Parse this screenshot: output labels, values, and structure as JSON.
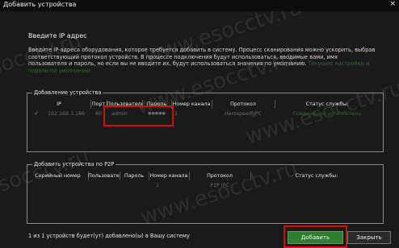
{
  "window": {
    "title": "Добавить устройства",
    "close_glyph": "×"
  },
  "intro": {
    "title": "Введите IP адрес",
    "description": "Введите IP-адреса оборудования, которое требуется добавить в систему. Процесс сканирования можно ускорить, выбрав соответствующий протокол устройств. В процессе подключения будут использоваться, вводимые вами, имя пользователя и пароль, но если вы не вводите их, будут использоваться значения по умолчанию.",
    "link": "Текущие настройки и пароли по умолчанию"
  },
  "add_group": {
    "title": "Добавление устройства",
    "columns": [
      "IP",
      "Порт",
      "Пользователь",
      "Пароль",
      "Номер канала",
      "Протокол",
      "Статус службы:"
    ],
    "rows": [
      {
        "checked": true,
        "check_glyph": "✔",
        "ip": "192.168.3.186",
        "port": "80",
        "user": "admin",
        "password": "●●●●●",
        "channel": "1",
        "protocol": "Herospeed|JPC",
        "status": "Соединение установлено"
      }
    ]
  },
  "p2p_group": {
    "title": "Добавить устройства по P2P",
    "columns": [
      "Серийный номер",
      "Пользователь",
      "Пароль",
      "Номер канала",
      "Протокол",
      "Статус службы:"
    ],
    "rows": [
      {
        "serial": "",
        "user": "",
        "password": "",
        "channel": "1",
        "protocol": "P2P IPC",
        "status": ""
      }
    ]
  },
  "footer": {
    "status_text": "1 из 1 устройств будет(ут) добавлено(ы) в Вашу систему",
    "add_label": "Добавить",
    "close_label": "Закрыть"
  },
  "watermark": "www.esocctv.ru",
  "colors": {
    "highlight": "#d01010",
    "button_green": "#2f7d2f",
    "status_green": "#2a6b2a"
  }
}
